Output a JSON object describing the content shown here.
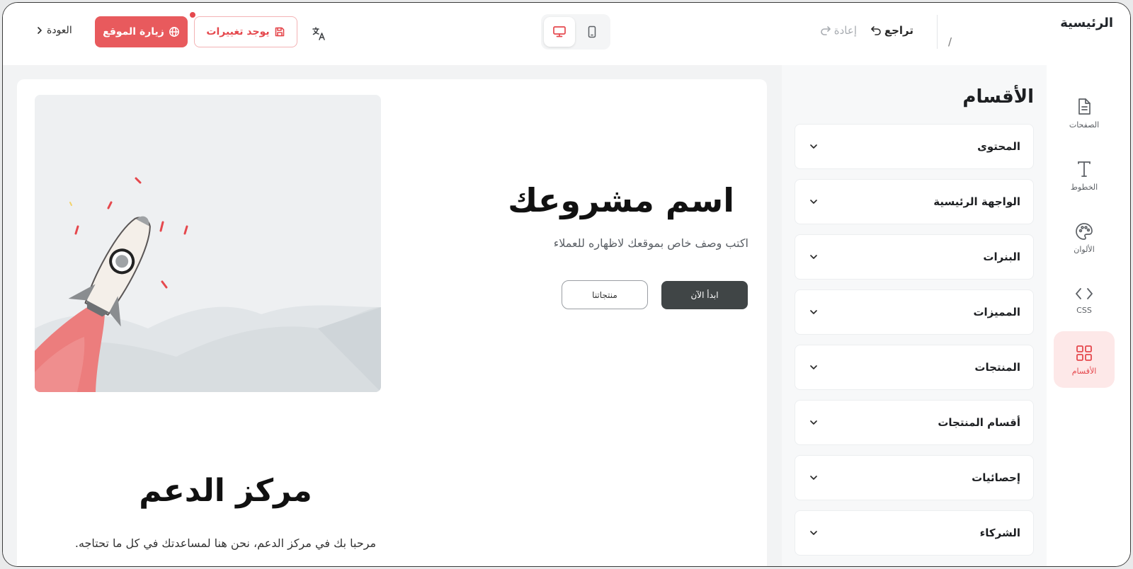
{
  "header": {
    "page_title": "الرئيسية",
    "breadcrumb_sep": "/",
    "undo_label": "تراجع",
    "redo_label": "إعادة",
    "changes_label": "يوجد تغييرات",
    "visit_label": "زيارة الموقع",
    "back_label": "العودة"
  },
  "rail": {
    "items": [
      {
        "label": "الصفحات",
        "icon": "document-icon"
      },
      {
        "label": "الخطوط",
        "icon": "text-icon"
      },
      {
        "label": "الألوان",
        "icon": "palette-icon"
      },
      {
        "label": "CSS",
        "icon": "code-icon"
      },
      {
        "label": "الأقسام",
        "icon": "grid-icon",
        "active": true
      }
    ]
  },
  "panel": {
    "title": "الأقسام",
    "sections": [
      {
        "label": "المحتوى"
      },
      {
        "label": "الواجهة الرئيسية"
      },
      {
        "label": "البنرات"
      },
      {
        "label": "المميزات"
      },
      {
        "label": "المنتجات"
      },
      {
        "label": "أقسام المنتجات"
      },
      {
        "label": "إحصائيات"
      },
      {
        "label": "الشركاء"
      }
    ]
  },
  "preview": {
    "hero": {
      "title": "اسم مشروعك",
      "description": "اكتب وصف خاص بموقعك لاظهاره للعملاء",
      "primary_button": "ابدأ الآن",
      "secondary_button": "منتجاتنا"
    },
    "support": {
      "title": "مركز الدعم",
      "description": "مرحبا بك في مركز الدعم، نحن هنا لمساعدتك في كل ما تحتاجه."
    }
  },
  "colors": {
    "accent": "#e5484d",
    "accent_light": "#fde8e8",
    "dark_button": "#404546"
  }
}
